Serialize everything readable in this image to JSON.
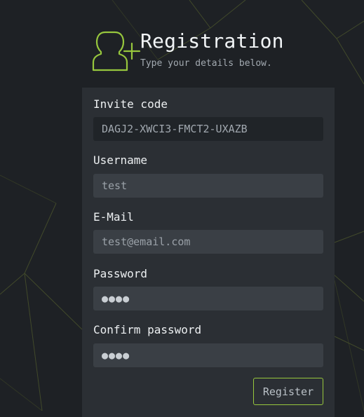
{
  "header": {
    "title": "Registration",
    "subtitle": "Type your details below.",
    "icon": "add-user-icon",
    "accent_color": "#97c73d"
  },
  "form": {
    "invite_code": {
      "label": "Invite code",
      "value": "DAGJ2-XWCI3-FMCT2-UXAZB"
    },
    "username": {
      "label": "Username",
      "value": "test"
    },
    "email": {
      "label": "E-Mail",
      "value": "test@email.com"
    },
    "password": {
      "label": "Password",
      "value": "●●●●"
    },
    "confirm_password": {
      "label": "Confirm password",
      "value": "●●●●"
    },
    "register_label": "Register"
  }
}
